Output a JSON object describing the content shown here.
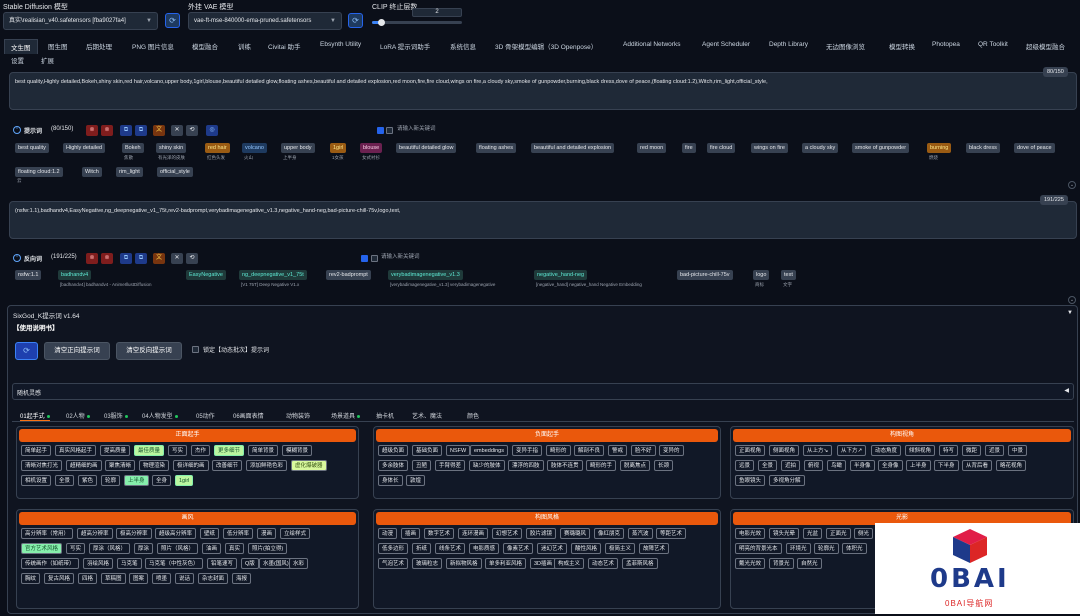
{
  "header": {
    "sd_model_label": "Stable Diffusion 模型",
    "sd_model_value": "真实\\realisian_v40.safetensors [fba9027fa4]",
    "vae_label": "外挂 VAE 模型",
    "vae_value": "vae-ft-mse-840000-ema-pruned.safetensors",
    "clip_label": "CLIP 终止层数",
    "clip_value": "2",
    "clip_fraction": 0.1
  },
  "tabs": [
    "文生图",
    "图生图",
    "后期处理",
    "PNG 图片信息",
    "模型融合",
    "训练",
    "Civitai 助手",
    "Ebsynth Utility",
    "LoRA 提示词助手",
    "系统信息",
    "3D 骨架模型编辑（3D Openpose）",
    "Additional Networks",
    "Agent Scheduler",
    "Depth Library",
    "无边图像浏览",
    "模型转换",
    "Photopea",
    "QR Toolkit",
    "超级模型融合",
    "设置",
    "扩展"
  ],
  "positive": {
    "text": "best quality,Highly detailed,Bokeh,shiny skin,red hair,volcano,upper body,1girl,blouse,beautiful detailed glow,floating ashes,beautiful and detailed explosion,red moon,fire,fire cloud,wings on fire,a cloudy sky,smoke of gunpowder,burning,black dress,dove of peace,(floating cloud:1.2),Witch,rim_light,official_style,",
    "count": "80/150",
    "label": "提示词",
    "label_count": "(80/150)",
    "input_placeholder": "请输入新关键词",
    "tags_row1": [
      {
        "t": "best quality",
        "s": ""
      },
      {
        "t": "Highly detailed",
        "s": ""
      },
      {
        "t": "Bokeh",
        "s": "焦散"
      },
      {
        "t": "shiny skin",
        "s": "有光泽的皮肤"
      },
      {
        "t": "red hair",
        "s": "红色头发"
      },
      {
        "t": "volcano",
        "s": "火山"
      },
      {
        "t": "upper body",
        "s": "上半身"
      },
      {
        "t": "1girl",
        "s": "1女孩"
      },
      {
        "t": "blouse",
        "s": "女式衬衫"
      },
      {
        "t": "beautiful detailed glow",
        "s": ""
      },
      {
        "t": "floating ashes",
        "s": ""
      },
      {
        "t": "beautiful and detailed explosion",
        "s": ""
      },
      {
        "t": "red moon",
        "s": ""
      },
      {
        "t": "fire",
        "s": ""
      },
      {
        "t": "fire cloud",
        "s": ""
      },
      {
        "t": "wings on fire",
        "s": ""
      },
      {
        "t": "a cloudy sky",
        "s": ""
      },
      {
        "t": "smoke of gunpowder",
        "s": ""
      },
      {
        "t": "burning",
        "s": "燃烧"
      },
      {
        "t": "black dress",
        "s": ""
      },
      {
        "t": "dove of peace",
        "s": ""
      }
    ],
    "tags_row2": [
      {
        "t": "floating cloud:1.2",
        "s": "云"
      },
      {
        "t": "Witch",
        "s": ""
      },
      {
        "t": "rim_light",
        "s": ""
      },
      {
        "t": "official_style",
        "s": ""
      }
    ]
  },
  "negative": {
    "text": "(nsfw:1.1),badhandv4,EasyNegative,ng_deepnegative_v1_75t,rev2-badprompt,verybadimagenegative_v1.3,negative_hand-neg,bad-picture-chill-75v,logo,text,",
    "count": "191/225",
    "label": "反向词",
    "label_count": "(191/225)",
    "input_placeholder": "请输入新关键词",
    "tags": [
      {
        "t": "nsfw:1.1",
        "s": ""
      },
      {
        "t": "badhandv4",
        "s": "[badhandv4] badhandv4 - AnimeIllustDiffusion"
      },
      {
        "t": "EasyNegative",
        "s": ""
      },
      {
        "t": "ng_deepnegative_v1_75t",
        "s": "[V1 75T] Deep Negative V1.x"
      },
      {
        "t": "rev2-badprompt",
        "s": ""
      },
      {
        "t": "verybadimagenegative_v1.3",
        "s": "[verybadimagenegative_v1.3] verybadimagenegative"
      },
      {
        "t": "negative_hand-neg",
        "s": "[negative_hand] negative_hand Negative Embedding"
      },
      {
        "t": "bad-picture-chill-75v",
        "s": ""
      },
      {
        "t": "logo",
        "s": "商标"
      },
      {
        "t": "text",
        "s": "文字"
      }
    ]
  },
  "sixgod": {
    "title": "SixGod_K提示词 v1.64",
    "manual": "【使用说明书】",
    "btn_clear_pos": "清空正向提示词",
    "btn_clear_neg": "清空反向提示词",
    "lock_label": "锁定【动态批次】提示词",
    "random_label": "随机灵感",
    "subtabs": [
      "01起手式",
      "02人物",
      "03服饰",
      "04人物发型",
      "05动作",
      "06画面表情",
      "动物装饰",
      "场景道具",
      "抽卡机",
      "艺术、魔法",
      "颜色"
    ],
    "panels": [
      {
        "title": "正面起手",
        "chips": [
          [
            "简单起手",
            "真实风格起手",
            "提高质量",
            "最佳质量",
            "写实",
            "杰作",
            "更多细节",
            "简单背景",
            "模糊背景"
          ],
          [
            "清晰对焦打光",
            "超精细的画",
            "聚焦清晰",
            "物理渲染",
            "极详细的画",
            "改善细节",
            "添加鲜艳色彩",
            "虚化爆破器"
          ],
          [
            "相机设置",
            "全景",
            "紫色",
            "轮廓",
            "上半身",
            "全身",
            "1girl"
          ]
        ]
      },
      {
        "title": "负面起手",
        "chips": [
          [
            "超级负面",
            "基础负面",
            "NSFW",
            "embeddings",
            "变异手指",
            "畸形的",
            "解剖不良",
            "警戒",
            "脸不好",
            "变异的"
          ],
          [
            "多余肢体",
            "丑陋",
            "手臂得差",
            "缺少的肢体",
            "漂浮的四肢",
            "肢体不连贯",
            "畸形的手",
            "脱离焦点",
            "长颈"
          ],
          [
            "身体长",
            "敦煌"
          ]
        ]
      },
      {
        "title": "构图视角",
        "chips": [
          [
            "正面视角",
            "侧面视角",
            "从上方↘",
            "从下方↗",
            "动态角度",
            "倾斜视角",
            "特写",
            "微距",
            "近景",
            "中景"
          ],
          [
            "远景",
            "全景",
            "近拍",
            "俯视",
            "鸟瞰",
            "半身像",
            "全身像",
            "上半身",
            "下半身",
            "从背后看",
            "略花视角"
          ],
          [
            "鱼眼镜头",
            "多视角分解"
          ]
        ]
      },
      {
        "title": "画风",
        "chips": [
          [
            "高分辨率（常用）",
            "超高分辨率",
            "极高分辨率",
            "超级高分辨率",
            "壁纸",
            "低分辨率",
            "漫画",
            "立绘样式"
          ],
          [
            "官方艺术风格",
            "写实",
            "厚涂（风格）",
            "厚涂",
            "照片（风格）",
            "油画",
            "真实",
            "照片(拍立得)"
          ],
          [
            "传统画作（如纸带）",
            "羽绘风格",
            "马克笔",
            "马克笔（中性灰色）",
            "铅笔速写",
            "Q版",
            "水墨(国风)",
            "水彩"
          ],
          [
            "胸纹",
            "复古风格",
            "四格",
            "草稿图",
            "图案",
            "喷墨",
            "说话",
            "杂志封面",
            "海报"
          ]
        ]
      },
      {
        "title": "构图风格",
        "chips": [
          [
            "动漫",
            "插画",
            "数字艺术",
            "连环漫画",
            "幻想艺术",
            "胶片滤镜",
            "赛璐璐风",
            "像红朋克",
            "蒸汽波",
            "等距艺术"
          ],
          [
            "低多边形",
            "折纸",
            "线条艺术",
            "电影质感",
            "像素艺术",
            "迷幻艺术",
            "酸性风格",
            "极简主义",
            "故障艺术"
          ],
          [
            "气泡艺术",
            "玻璃粒志",
            "新拟物风格",
            "单多利亚风格",
            "3D插画",
            "构成主义",
            "动态艺术",
            "孟菲斯风格"
          ]
        ]
      },
      {
        "title": "光影",
        "chips": [
          [
            "电影光效",
            "镜头光晕",
            "光盆",
            "正面光",
            "侧光"
          ],
          [
            "明亮的背景光本",
            "环境光",
            "轮廓光",
            "体积光"
          ],
          [
            "戴光光效",
            "背景光",
            "自然光"
          ]
        ]
      }
    ]
  },
  "watermark": {
    "text": "0BAI",
    "subtext": "0BAI导航网"
  }
}
